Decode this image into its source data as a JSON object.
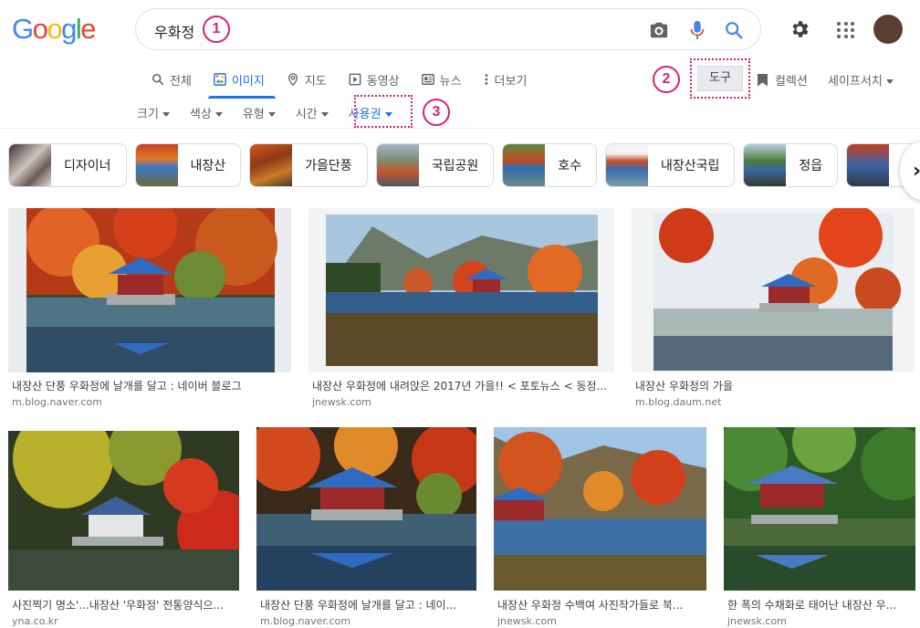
{
  "logo": [
    "G",
    "o",
    "o",
    "g",
    "l",
    "e"
  ],
  "search": {
    "query": "우화정"
  },
  "annotations": {
    "one": "1",
    "two": "2",
    "three": "3"
  },
  "tabs": [
    {
      "label": "전체",
      "icon": "search-icon"
    },
    {
      "label": "이미지",
      "icon": "image-icon",
      "active": true
    },
    {
      "label": "지도",
      "icon": "map-pin-icon"
    },
    {
      "label": "동영상",
      "icon": "video-icon"
    },
    {
      "label": "뉴스",
      "icon": "news-icon"
    },
    {
      "label": "더보기",
      "icon": "more-vert-icon"
    }
  ],
  "tools": {
    "label": "도구"
  },
  "collection": {
    "label": "컬렉션"
  },
  "safesearch": {
    "label": "세이프서치"
  },
  "filters": [
    {
      "label": "크기"
    },
    {
      "label": "색상"
    },
    {
      "label": "유형"
    },
    {
      "label": "시간"
    },
    {
      "label": "사용권",
      "active": true
    }
  ],
  "chips": [
    {
      "label": "디자이너"
    },
    {
      "label": "내장산"
    },
    {
      "label": "가을단풍"
    },
    {
      "label": "국립공원"
    },
    {
      "label": "호수"
    },
    {
      "label": "내장산국립"
    },
    {
      "label": "정읍"
    },
    {
      "label": ""
    }
  ],
  "results_row1": [
    {
      "title": "내장산 단풍 우화정에 날개를 달고 : 네이버 블로그",
      "source": "m.blog.naver.com"
    },
    {
      "title": "내장산 우화정에 내려앉은 2017년 가을!! < 포토뉴스 < 동정...",
      "source": "jnewsk.com"
    },
    {
      "title": "내장산 우화정의 가을",
      "source": "m.blog.daum.net"
    }
  ],
  "results_row2": [
    {
      "title": "사진찍기 명소'...내장산 '우화정' 전통양식으...",
      "source": "yna.co.kr"
    },
    {
      "title": "내장산 단풍 우화정에 날개를 달고 : 네이...",
      "source": "m.blog.naver.com"
    },
    {
      "title": "내장산 우화정 수백여 사진작가들로 북...",
      "source": "jnewsk.com"
    },
    {
      "title": "한 폭의 수채화로 태어난 내장산 우...",
      "source": "jnewsk.com"
    }
  ],
  "colors": {
    "accent": "#1a73e8",
    "annotation": "#d6246e"
  }
}
